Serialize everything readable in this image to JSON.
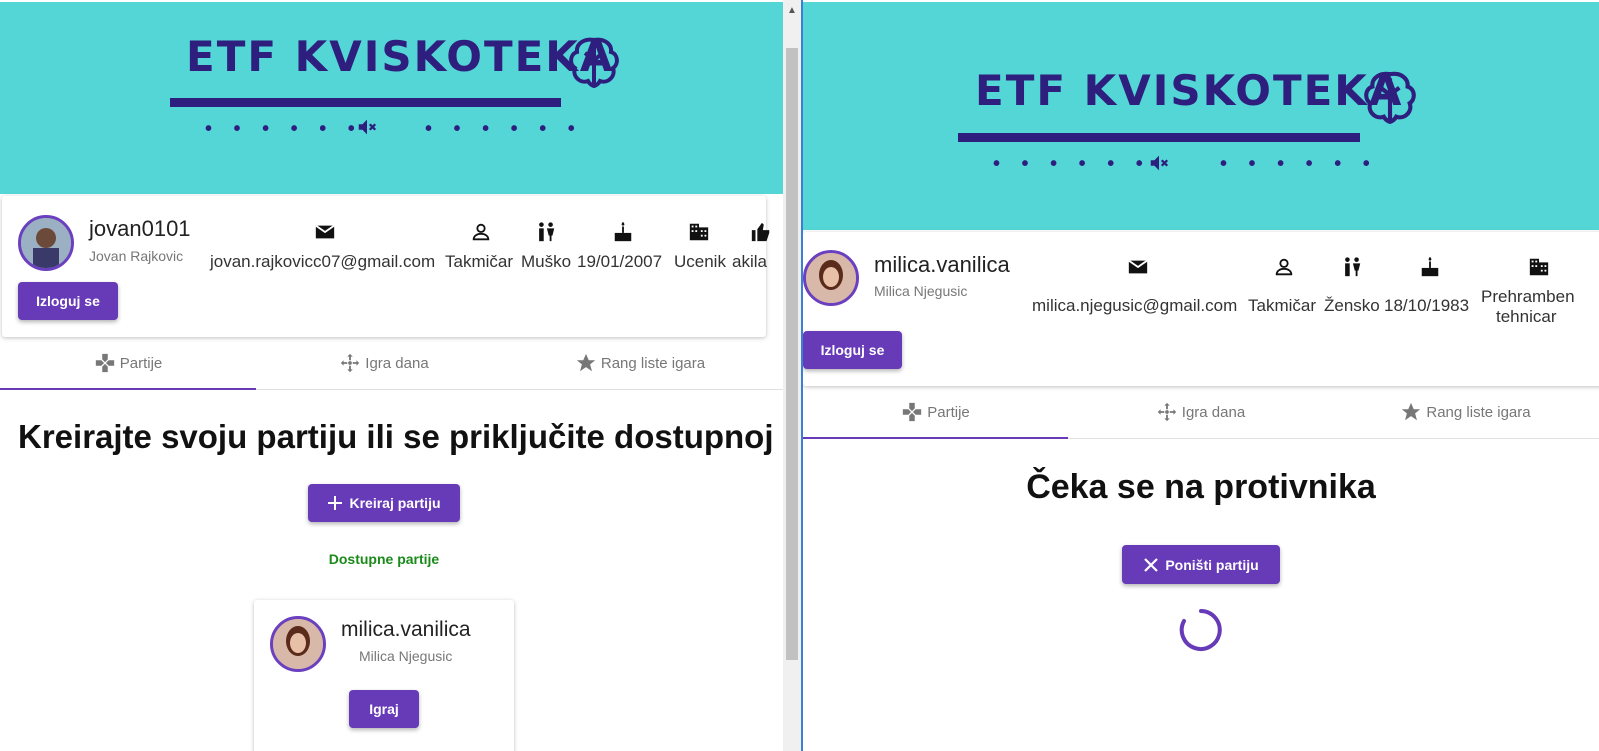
{
  "left": {
    "brand": "ETF KVISKOTEKA",
    "brand_dots_left": "• • • • • •",
    "brand_dots_right": "• • • • • •",
    "profile": {
      "username": "jovan0101",
      "fullname": "Jovan Rajkovic",
      "email": "jovan.rajkovicc07@gmail.com",
      "role": "Takmičar",
      "gender": "Muško",
      "birthdate": "19/01/2007",
      "occupation": "Ucenik",
      "extra": "akila"
    },
    "logout_label": "Izloguj se",
    "tabs": [
      "Partije",
      "Igra dana",
      "Rang liste igara"
    ],
    "heading": "Kreirajte svoju partiju ili se priključite dostupnoj",
    "create_label": "Kreiraj partiju",
    "available_label": "Dostupne partije",
    "game_card": {
      "username": "milica.vanilica",
      "fullname": "Milica Njegusic",
      "play_label": "Igraj"
    }
  },
  "right": {
    "brand": "ETF KVISKOTEKA",
    "brand_dots_left": "• • • • • •",
    "brand_dots_right": "• • • • • •",
    "profile": {
      "username": "milica.vanilica",
      "fullname": "Milica Njegusic",
      "email": "milica.njegusic@gmail.com",
      "role": "Takmičar",
      "gender": "Žensko",
      "birthdate": "18/10/1983",
      "occupation_line1": "Prehramben",
      "occupation_line2": "tehnicar"
    },
    "logout_label": "Izloguj se",
    "tabs": [
      "Partije",
      "Igra dana",
      "Rang liste igara"
    ],
    "heading": "Čeka se na protivnika",
    "cancel_label": "Poništi partiju"
  },
  "colors": {
    "banner": "#54d6d6",
    "brand": "#2e1e7e",
    "accent": "#673ab7",
    "available": "#1a8a1a"
  }
}
